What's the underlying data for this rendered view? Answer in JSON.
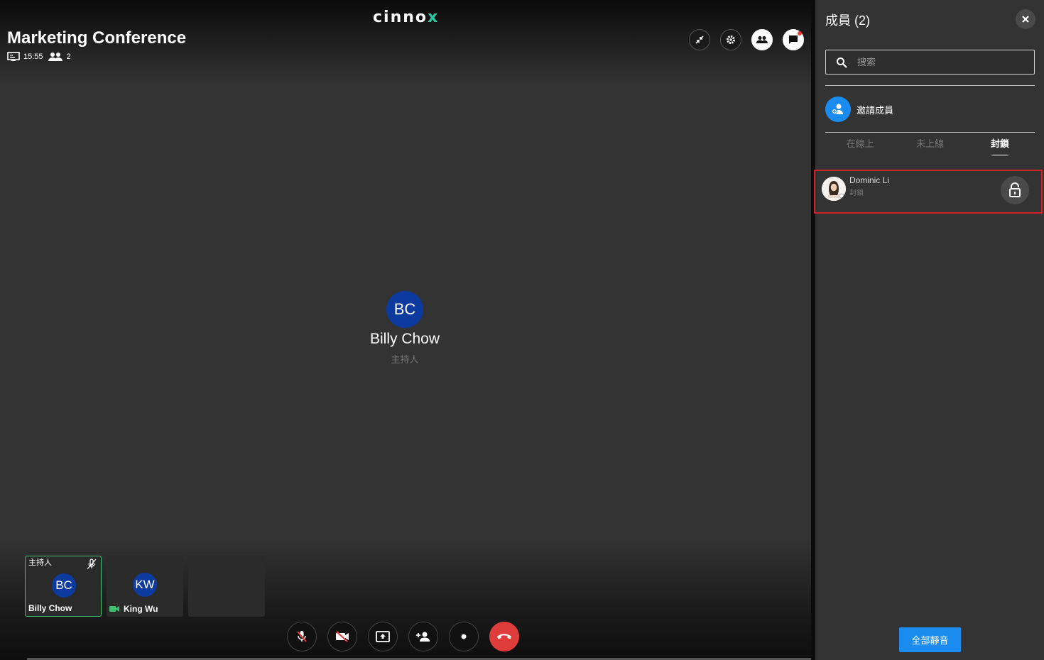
{
  "header": {
    "logo_main": "cinno",
    "logo_accent": "x",
    "conference_title": "Marketing Conference",
    "duration": "15:55",
    "participant_count": "2"
  },
  "speaker": {
    "initials": "BC",
    "name": "Billy Chow",
    "role": "主持人"
  },
  "thumbnails": [
    {
      "role": "主持人",
      "initials": "BC",
      "name": "Billy Chow"
    },
    {
      "initials": "KW",
      "name": "King Wu"
    }
  ],
  "panel": {
    "title": "成員 (2)",
    "search_placeholder": "搜索",
    "invite_label": "邀請成員",
    "tabs": [
      "在線上",
      "未上線",
      "封鎖"
    ],
    "active_tab": "封鎖",
    "members": [
      {
        "name": "Dominic Li",
        "status": "封鎖"
      }
    ],
    "mute_all_label": "全部靜音"
  },
  "icons": {
    "top_actions": [
      "collapse-icon",
      "settings-icon",
      "members-icon",
      "chat-icon"
    ],
    "controls": [
      "mic-off-icon",
      "video-off-icon",
      "share-screen-icon",
      "add-person-icon",
      "record-icon",
      "end-call-icon"
    ]
  },
  "colors": {
    "accent_blue": "#1a8cf0",
    "avatar_blue": "#0d3a9e",
    "end_call_red": "#e03c3c",
    "active_green": "#3fbf6f",
    "highlight_red": "#d0202a",
    "logo_teal": "#2cc6a0"
  }
}
